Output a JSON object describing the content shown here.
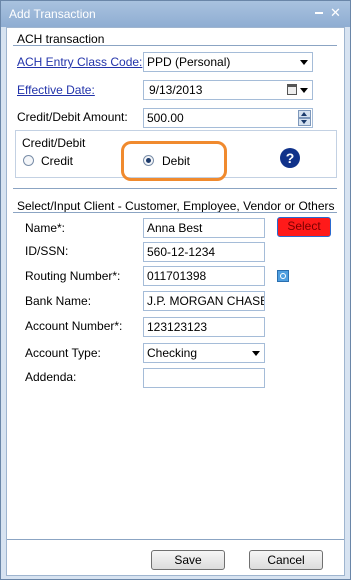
{
  "window": {
    "title": "Add Transaction",
    "minimize_glyph": "_",
    "close_glyph": "✕"
  },
  "ach_section": {
    "title": "ACH transaction",
    "entry_class": {
      "label": "ACH Entry Class  Code:",
      "value": "PPD (Personal)"
    },
    "effective_date": {
      "label": "Effective Date:",
      "value": "9/13/2013"
    },
    "amount": {
      "label": "Credit/Debit Amount:",
      "value": "500.00"
    },
    "credit_debit": {
      "title": "Credit/Debit",
      "credit_label": "Credit",
      "debit_label": "Debit",
      "selected": "Debit",
      "help_glyph": "?"
    }
  },
  "client_section": {
    "title": "Select/Input Client - Customer, Employee, Vendor or Others",
    "name": {
      "label": "Name*:",
      "value": "Anna Best"
    },
    "select_button": "Select",
    "id_ssn": {
      "label": "ID/SSN:",
      "value": "560-12-1234"
    },
    "routing": {
      "label": "Routing Number*:",
      "value": "011701398"
    },
    "bank_name": {
      "label": "Bank Name:",
      "value": "J.P. MORGAN CHASE B"
    },
    "account_number": {
      "label": "Account Number*:",
      "value": "123123123"
    },
    "account_type": {
      "label": "Account Type:",
      "value": "Checking"
    },
    "addenda": {
      "label": "Addenda:",
      "value": ""
    }
  },
  "footer": {
    "save": "Save",
    "cancel": "Cancel"
  },
  "colors": {
    "highlight": "#f08a2e",
    "select_button": "#ff1a1a",
    "link": "#2233aa"
  }
}
